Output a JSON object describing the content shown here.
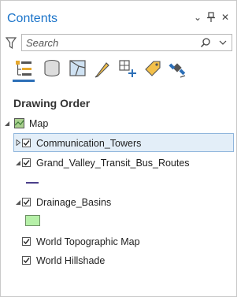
{
  "pane": {
    "title": "Contents",
    "controls": {
      "options": "⌄",
      "pin": "🖈",
      "close": "✕"
    }
  },
  "search": {
    "placeholder": "Search",
    "value": ""
  },
  "toolbar": {
    "items": [
      {
        "name": "list-by-drawing-order-icon"
      },
      {
        "name": "list-by-data-source-icon"
      },
      {
        "name": "list-by-selection-icon"
      },
      {
        "name": "list-by-editing-icon"
      },
      {
        "name": "list-by-snapping-icon"
      },
      {
        "name": "list-by-labeling-icon"
      },
      {
        "name": "list-by-perspective-imagery-icon"
      }
    ]
  },
  "section": {
    "title": "Drawing Order"
  },
  "tree": {
    "map_label": "Map",
    "layers": [
      {
        "label": "Communication_Towers",
        "checked": true,
        "expanded": false,
        "selected": true
      },
      {
        "label": "Grand_Valley_Transit_Bus_Routes",
        "checked": true,
        "expanded": true,
        "symbol": "line",
        "symbol_color": "#4b3f8a"
      },
      {
        "label": "Drainage_Basins",
        "checked": true,
        "expanded": true,
        "symbol": "polygon",
        "symbol_color": "#b6f0a8"
      },
      {
        "label": "World Topographic Map",
        "checked": true
      },
      {
        "label": "World Hillshade",
        "checked": true
      }
    ]
  },
  "colors": {
    "accent": "#1a73c9",
    "selection_fill": "#e3eef8",
    "selection_border": "#8fb5dc"
  }
}
